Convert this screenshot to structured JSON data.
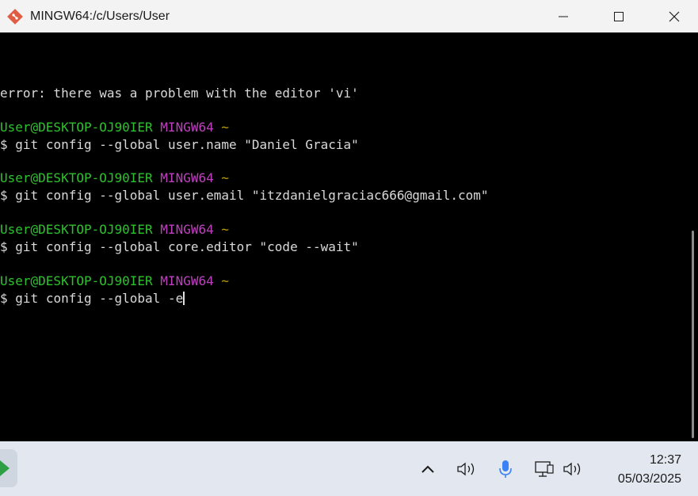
{
  "window": {
    "title": "MINGW64:/c/Users/User",
    "icon": "git-bash-icon",
    "controls": {
      "minimize": "minimize-icon",
      "maximize": "maximize-icon",
      "close": "close-icon"
    }
  },
  "terminal": {
    "colors": {
      "background": "#000000",
      "text": "#d9d9d9",
      "user": "#2dc22d",
      "host": "#bf40bf",
      "path": "#c0a000"
    },
    "error_line": "error: there was a problem with the editor 'vi'",
    "prompt": {
      "user_host": "User@DESKTOP-OJ90IER",
      "shell": "MINGW64",
      "path": "~",
      "symbol": "$"
    },
    "commands": [
      "git config --global user.name \"Daniel Gracia\"",
      "git config --global user.email \"itzdanielgraciac666@gmail.com\"",
      "git config --global core.editor \"code --wait\"",
      "git config --global -e"
    ]
  },
  "taskbar": {
    "tray_icons": [
      "chevron-up-icon",
      "speaker-icon",
      "microphone-icon",
      "network-icon",
      "volume-icon"
    ],
    "clock": {
      "time": "12:37",
      "date": "05/03/2025"
    }
  }
}
